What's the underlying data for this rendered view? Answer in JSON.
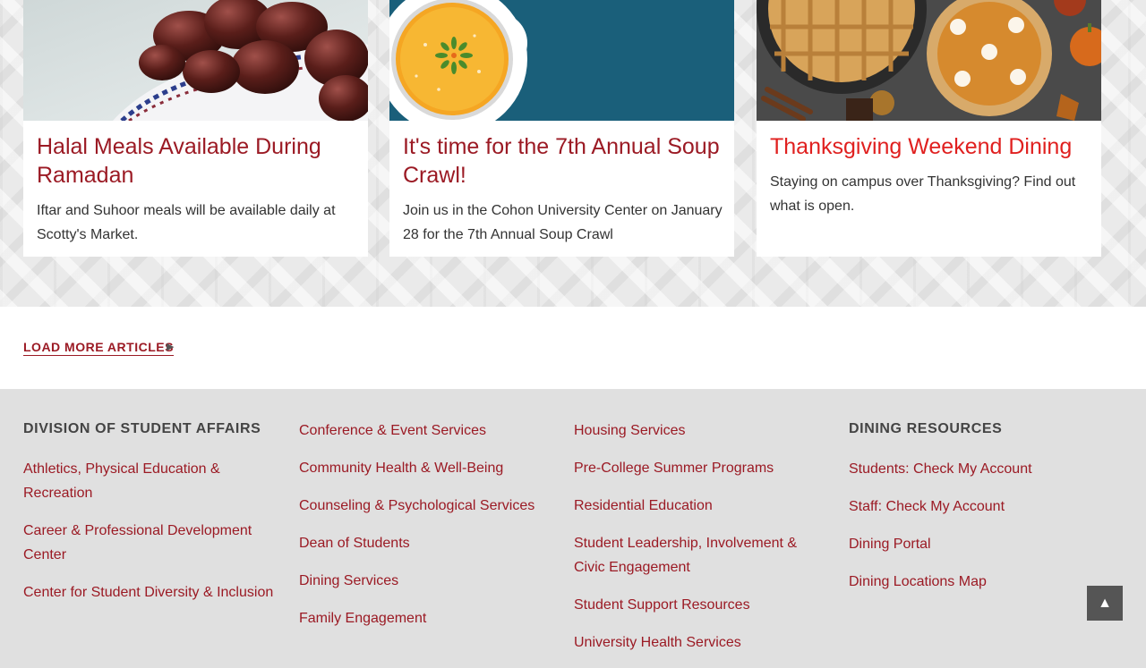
{
  "articles": [
    {
      "title": "Halal Meals Available During Ramadan",
      "description": "Iftar and Suhoor meals will be available daily at Scotty's Market.",
      "image": "dates-photo"
    },
    {
      "title": "It's time for the 7th Annual Soup Crawl!",
      "description": "Join us in the Cohon University Center on January 28 for the 7th Annual Soup Crawl",
      "image": "soup-illustration"
    },
    {
      "title": "Thanksgiving Weekend Dining",
      "description": "Staying on campus over Thanksgiving? Find out what is open.",
      "image": "pies-photo"
    }
  ],
  "load_more": {
    "label": "LOAD MORE ARTICLES",
    "arrow": "▶"
  },
  "footer": {
    "col1": {
      "heading": "DIVISION OF STUDENT AFFAIRS",
      "links": [
        "Athletics, Physical Education & Recreation",
        "Career & Professional Development Center",
        "Center for Student Diversity & Inclusion"
      ]
    },
    "col2": {
      "links": [
        "Conference & Event Services",
        "Community Health & Well-Being",
        "Counseling & Psychological Services",
        "Dean of Students",
        "Dining Services",
        "Family Engagement"
      ]
    },
    "col3": {
      "links": [
        "Housing Services",
        "Pre-College Summer Programs",
        "Residential Education",
        "Student Leadership, Involvement & Civic Engagement",
        "Student Support Resources",
        "University Health Services"
      ]
    },
    "col4": {
      "heading": "DINING RESOURCES",
      "links": [
        "Students: Check My Account",
        "Staff: Check My Account",
        "Dining Portal",
        "Dining Locations Map"
      ]
    }
  },
  "back_to_top": {
    "icon": "▲"
  },
  "colors": {
    "link": "#9b1a24",
    "link_hover": "#e0201f",
    "soup_bg": "#1a5f7a",
    "footer_bg": "#e0e0e0"
  }
}
